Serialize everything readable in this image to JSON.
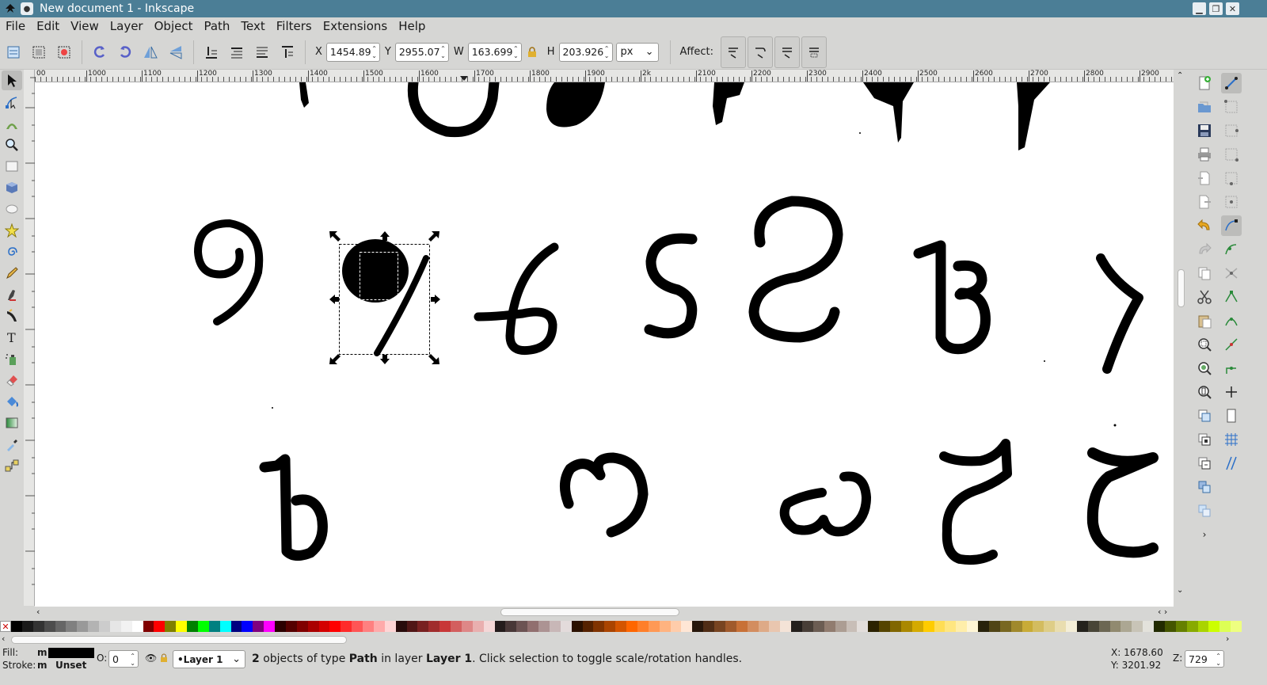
{
  "window": {
    "title": "New document 1 - Inkscape"
  },
  "menu": [
    "File",
    "Edit",
    "View",
    "Layer",
    "Object",
    "Path",
    "Text",
    "Filters",
    "Extensions",
    "Help"
  ],
  "toolbar": {
    "x_label": "X",
    "x_value": "1454.89",
    "y_label": "Y",
    "y_value": "2955.07",
    "w_label": "W",
    "w_value": "163.699",
    "h_label": "H",
    "h_value": "203.926",
    "unit": "px",
    "affect_label": "Affect:"
  },
  "ruler": {
    "labels": [
      "00",
      "1000",
      "1100",
      "1200",
      "1300",
      "1400",
      "1500",
      "1600",
      "1700",
      "1800",
      "1900",
      "2k",
      "2100",
      "2200",
      "2300",
      "2400",
      "2500",
      "2600",
      "2700",
      "2800",
      "2900"
    ]
  },
  "status": {
    "fill_label": "Fill:",
    "fill_value": "m",
    "stroke_label": "Stroke:",
    "stroke_value": "m",
    "stroke_unset": "Unset",
    "opacity_label": "O:",
    "opacity_value": "0",
    "layer": "•Layer 1",
    "message_count": "2",
    "message_objects": " objects of type ",
    "message_type": "Path",
    "message_in_layer": " in layer ",
    "message_layer": "Layer 1",
    "message_hint": ". Click selection to toggle scale/rotation handles.",
    "cursor_x": "X: 1678.60",
    "cursor_y": "Y: 3201.92",
    "zoom_label": "Z:",
    "zoom_value": "729"
  },
  "palette_colors": [
    "#000000",
    "#1a1a1a",
    "#333333",
    "#4d4d4d",
    "#666666",
    "#808080",
    "#999999",
    "#b3b3b3",
    "#cccccc",
    "#e6e6e6",
    "#f2f2f2",
    "#ffffff",
    "#800000",
    "#ff0000",
    "#808000",
    "#ffff00",
    "#008000",
    "#00ff00",
    "#008080",
    "#00ffff",
    "#000080",
    "#0000ff",
    "#800080",
    "#ff00ff",
    "#2b0000",
    "#550000",
    "#800000",
    "#aa0000",
    "#d40000",
    "#ff0000",
    "#ff2a2a",
    "#ff5555",
    "#ff8080",
    "#ffaaaa",
    "#ffd5d5",
    "#280b0b",
    "#501616",
    "#782121",
    "#a02c2c",
    "#c83737",
    "#d35f5f",
    "#de8787",
    "#e9afaf",
    "#f4d7d7",
    "#241c1c",
    "#483737",
    "#6c5353",
    "#916f6f",
    "#ac9393",
    "#c8b7b7",
    "#e3dbdb",
    "#2b1100",
    "#552200",
    "#803300",
    "#aa4400",
    "#d45500",
    "#ff6600",
    "#ff7f2a",
    "#ff9955",
    "#ffb380",
    "#ffccaa",
    "#ffe6d5",
    "#28170b",
    "#502d16",
    "#784421",
    "#a05a2c",
    "#c87137",
    "#d38d5f",
    "#deaa87",
    "#e9c6af",
    "#f4e3d7",
    "#241f1c",
    "#483e37",
    "#6c5d53",
    "#917c6f",
    "#ac9d93",
    "#c8beb7",
    "#e3dedb",
    "#2b2200",
    "#554400",
    "#806600",
    "#aa8800",
    "#d4aa00",
    "#ffcc00",
    "#ffdd55",
    "#ffe680",
    "#ffeeaa",
    "#fff6d5",
    "#28220b",
    "#504416",
    "#786721",
    "#a0892c",
    "#c8ab37",
    "#d3bc5f",
    "#decd87",
    "#e9ddaf",
    "#f4eed7",
    "#24221c",
    "#484537",
    "#6c6753",
    "#918a6f",
    "#aca793",
    "#c8c4b7",
    "#e3e2db",
    "#222b00",
    "#445500",
    "#668000",
    "#88aa00",
    "#aad400",
    "#ccff00",
    "#ddff55",
    "#eeff80"
  ]
}
